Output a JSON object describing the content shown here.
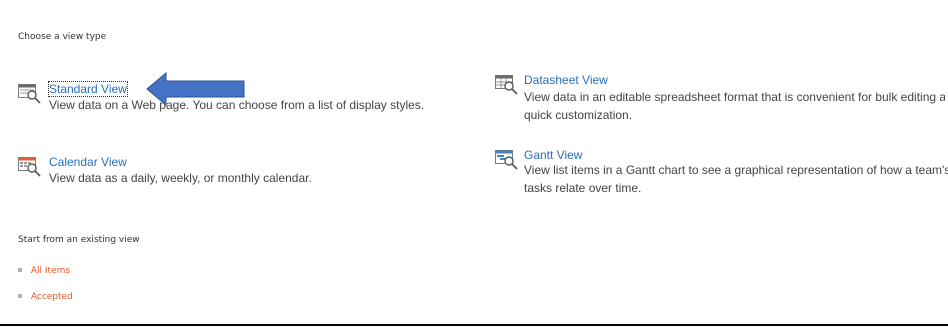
{
  "headings": {
    "view_type": "Choose a view type",
    "existing": "Start from an existing view"
  },
  "views": {
    "standard": {
      "title": "Standard View",
      "description": "View data on a Web page. You can choose from a list of display styles.",
      "icon": "standard-view-icon"
    },
    "calendar": {
      "title": "Calendar View",
      "description": "View data as a daily, weekly, or monthly calendar.",
      "icon": "calendar-view-icon"
    },
    "datasheet": {
      "title": "Datasheet View",
      "description_line1": "View data in an editable spreadsheet format that is convenient for bulk editing and",
      "description_line2": "quick customization.",
      "icon": "datasheet-view-icon"
    },
    "gantt": {
      "title": "Gantt View",
      "description_line1": "View list items in a Gantt chart to see a graphical representation of how a team's",
      "description_line2": "tasks relate over time.",
      "icon": "gantt-view-icon"
    }
  },
  "existing_views": [
    {
      "label": "All Items"
    },
    {
      "label": "Accepted"
    }
  ],
  "colors": {
    "link_blue": "#2a6ebb",
    "existing_link_orange": "#e8552c",
    "arrow_blue": "#4472c4"
  },
  "annotation": {
    "arrow": "left-pointing-arrow-icon"
  }
}
